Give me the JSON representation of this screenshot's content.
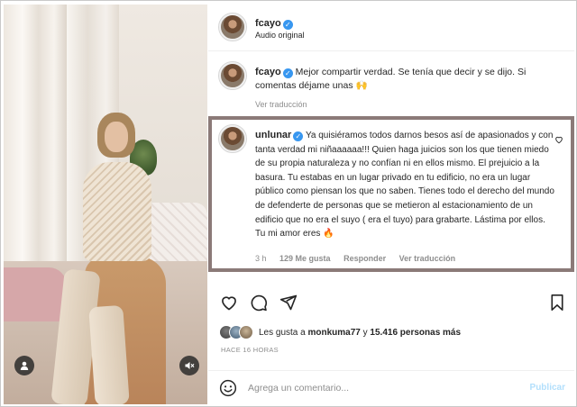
{
  "post": {
    "username": "fcayo",
    "audio": "Audio original",
    "caption": "Mejor compartir verdad. Se tenía que decir y se dijo. Si comentas déjame unas 🙌",
    "caption_translate": "Ver traducción"
  },
  "comment": {
    "username": "unlunar",
    "text": "Ya quisiéramos todos darnos besos así de apasionados y con tanta verdad mi niñaaaaaa!!! Quien haga juicios son los que tienen miedo de su propia naturaleza y no confían ni en ellos mismo. El prejuicio a la basura. Tu estabas en un lugar privado en tu edificio, no era un lugar público como piensan los que no saben. Tienes todo el derecho del mundo de defenderte de personas que se metieron al estacionamiento de un edificio que no era el suyo ( era el tuyo) para grabarte. Lástima por ellos. Tu mi amor eres 🔥",
    "time": "3 h",
    "likes": "129 Me gusta",
    "reply": "Responder",
    "translate": "Ver traducción"
  },
  "likes": {
    "prefix": "Les gusta a",
    "user": "monkuma77",
    "middle": "y",
    "others": "15.416 personas más"
  },
  "time_ago": "HACE 16 HORAS",
  "composer": {
    "placeholder": "Agrega un comentario...",
    "publish": "Publicar"
  },
  "colors": {
    "verified": "#3897f0",
    "highlight_border": "#8b7a78",
    "publish_disabled": "#b2dffc"
  }
}
